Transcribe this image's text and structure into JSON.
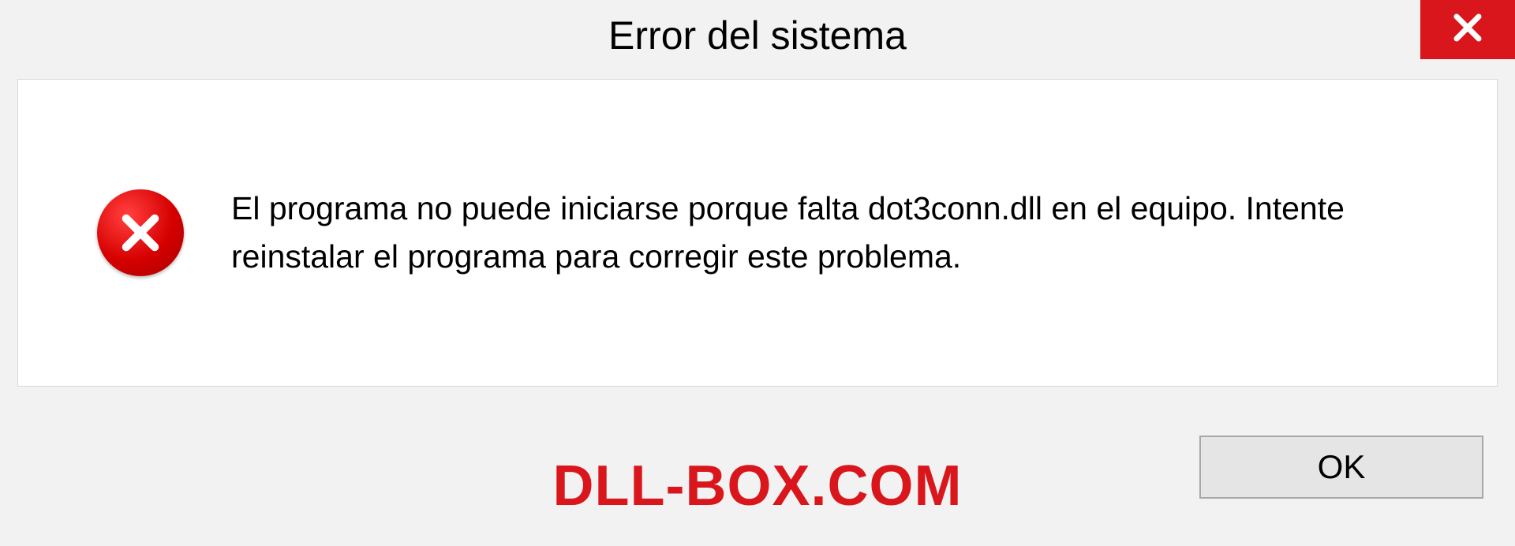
{
  "titlebar": {
    "title": "Error del sistema",
    "close_icon": "close"
  },
  "content": {
    "error_icon": "error-cross",
    "message": "El programa no puede iniciarse porque falta dot3conn.dll en el equipo. Intente reinstalar el programa para corregir este problema."
  },
  "footer": {
    "watermark": "DLL-BOX.COM",
    "ok_label": "OK"
  },
  "colors": {
    "accent_red": "#d9161c",
    "panel_bg": "#ffffff",
    "window_bg": "#f2f2f2",
    "button_bg": "#e5e5e5",
    "button_border": "#a8a8a8"
  }
}
